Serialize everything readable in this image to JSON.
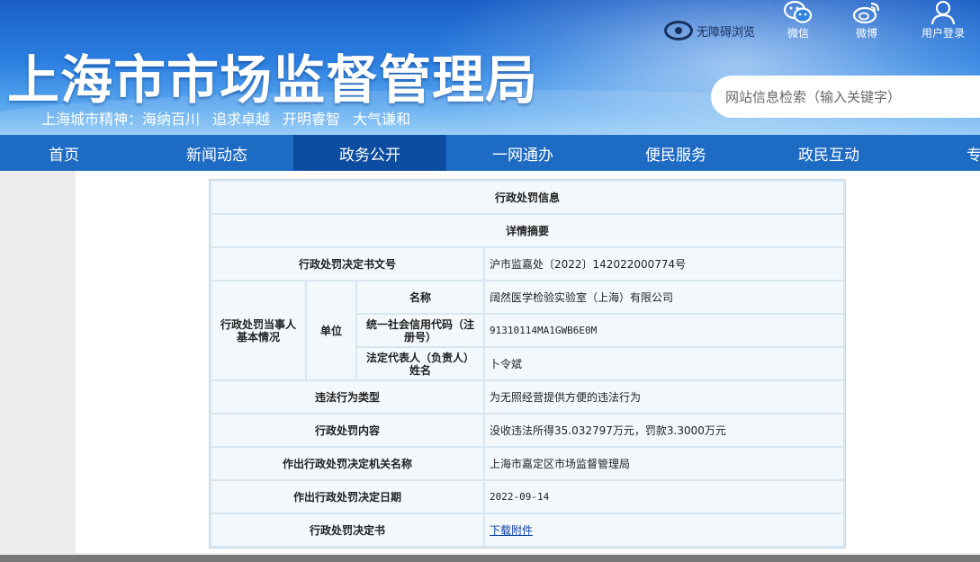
{
  "header": {
    "site_title": "上海市市场监督管理局",
    "slogan": [
      "上海城市精神：",
      "海纳百川",
      "追求卓越",
      "开明睿智",
      "大气谦和"
    ],
    "accessibility_label": "无障碍浏览",
    "tools": [
      {
        "label": "微信",
        "icon": "wechat-icon"
      },
      {
        "label": "微博",
        "icon": "weibo-icon"
      },
      {
        "label": "用户登录",
        "icon": "user-icon"
      }
    ],
    "search_placeholder": "网站信息检索（输入关键字）"
  },
  "nav": {
    "items": [
      "首页",
      "新闻动态",
      "政务公开",
      "一网通办",
      "便民服务",
      "政民互动",
      "专题"
    ],
    "active_index": 2
  },
  "table": {
    "title": "行政处罚信息",
    "subtitle": "详情摘要",
    "doc_number_label": "行政处罚决定书文号",
    "doc_number": "沪市监嘉处〔2022〕142022000774号",
    "party_label": "行政处罚当事人基本情况",
    "unit_label": "单位",
    "name_label": "名称",
    "name": "阔然医学检验实验室（上海）有限公司",
    "credit_code_label": "统一社会信用代码（注册号）",
    "credit_code": "91310114MA1GWB6E0M",
    "legal_rep_label": "法定代表人（负责人）姓名",
    "legal_rep": "卜令斌",
    "violation_type_label": "违法行为类型",
    "violation_type": "为无照经营提供方便的违法行为",
    "penalty_content_label": "行政处罚内容",
    "penalty_content": "没收违法所得35.032797万元，罚款3.3000万元",
    "authority_label": "作出行政处罚决定机关名称",
    "authority": "上海市嘉定区市场监督管理局",
    "decision_date_label": "作出行政处罚决定日期",
    "decision_date": "2022-09-14",
    "decision_doc_label": "行政处罚决定书",
    "decision_doc_link": "下载附件"
  },
  "colors": {
    "nav_bg": "#1e6bc4",
    "nav_active": "#0d4da1",
    "table_border": "#d8e6f2",
    "cell_bg": "#f3f8fc",
    "link": "#0b3fa8"
  }
}
